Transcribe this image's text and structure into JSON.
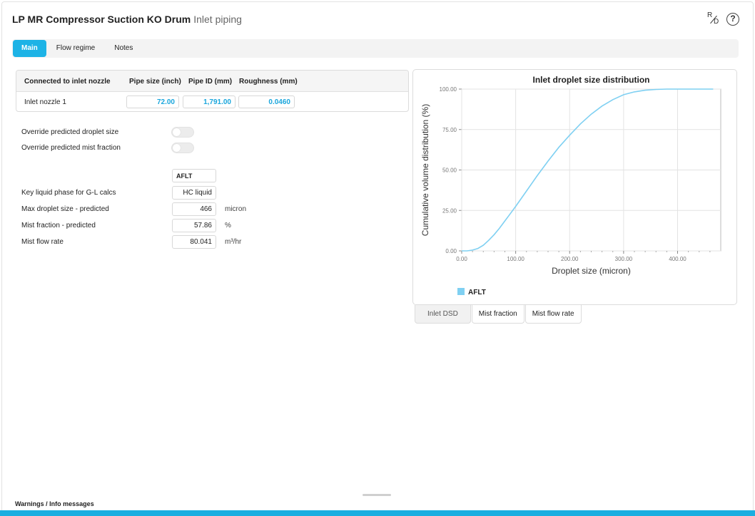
{
  "header": {
    "title": "LP MR Compressor Suction KO Drum",
    "subtitle": "Inlet piping",
    "rd_icon": "R/D",
    "help_icon": "?"
  },
  "tabs": [
    {
      "label": "Main",
      "active": true
    },
    {
      "label": "Flow regime",
      "active": false
    },
    {
      "label": "Notes",
      "active": false
    }
  ],
  "pipe_table": {
    "headers": [
      "Connected to inlet nozzle",
      "Pipe size (inch)",
      "Pipe ID (mm)",
      "Roughness (mm)"
    ],
    "row": {
      "label": "Inlet nozzle 1",
      "pipe_size": "72.00",
      "pipe_id": "1,791.00",
      "roughness": "0.0460"
    }
  },
  "toggles": [
    {
      "label": "Override predicted droplet size",
      "on": false
    },
    {
      "label": "Override predicted mist fraction",
      "on": false
    }
  ],
  "properties": {
    "column_header": "AFLT",
    "rows": [
      {
        "label": "Key liquid phase for G-L calcs",
        "value": "HC liquid",
        "unit": ""
      },
      {
        "label": "Max droplet size - predicted",
        "value": "466",
        "unit": "micron"
      },
      {
        "label": "Mist fraction - predicted",
        "value": "57.86",
        "unit": "%"
      },
      {
        "label": "Mist flow rate",
        "value": "80.041",
        "unit": "m³/hr"
      }
    ]
  },
  "chart_data": {
    "type": "line",
    "title": "Inlet droplet size distribution",
    "xlabel": "Droplet size (micron)",
    "ylabel": "Cumulative volume distribution (%)",
    "xlim": [
      0,
      480
    ],
    "ylim": [
      0,
      100
    ],
    "x_ticks": [
      "0.00",
      "100.00",
      "200.00",
      "300.00",
      "400.00"
    ],
    "y_ticks": [
      "0.00",
      "25.00",
      "50.00",
      "75.00",
      "100.00"
    ],
    "grid": true,
    "legend_position": "bottom-left",
    "series": [
      {
        "name": "AFLT",
        "color": "#7fd0f2",
        "x": [
          0,
          10,
          20,
          30,
          40,
          50,
          60,
          70,
          80,
          90,
          100,
          120,
          140,
          160,
          180,
          200,
          220,
          240,
          260,
          280,
          300,
          320,
          340,
          360,
          380,
          400,
          420,
          440,
          466
        ],
        "y": [
          0,
          0,
          0.5,
          1.5,
          3.5,
          6.5,
          10,
          14,
          18.5,
          23,
          27.5,
          37,
          46.5,
          55.5,
          64,
          71.5,
          78.5,
          84.5,
          89.5,
          93.5,
          96.5,
          98.3,
          99.3,
          99.8,
          100,
          100,
          100,
          100,
          100
        ]
      }
    ]
  },
  "chart_tabs": [
    {
      "label": "Inlet DSD",
      "active": true
    },
    {
      "label": "Mist fraction",
      "active": false
    },
    {
      "label": "Mist flow rate",
      "active": false
    }
  ],
  "footer": {
    "warnings_label": "Warnings / Info messages"
  }
}
